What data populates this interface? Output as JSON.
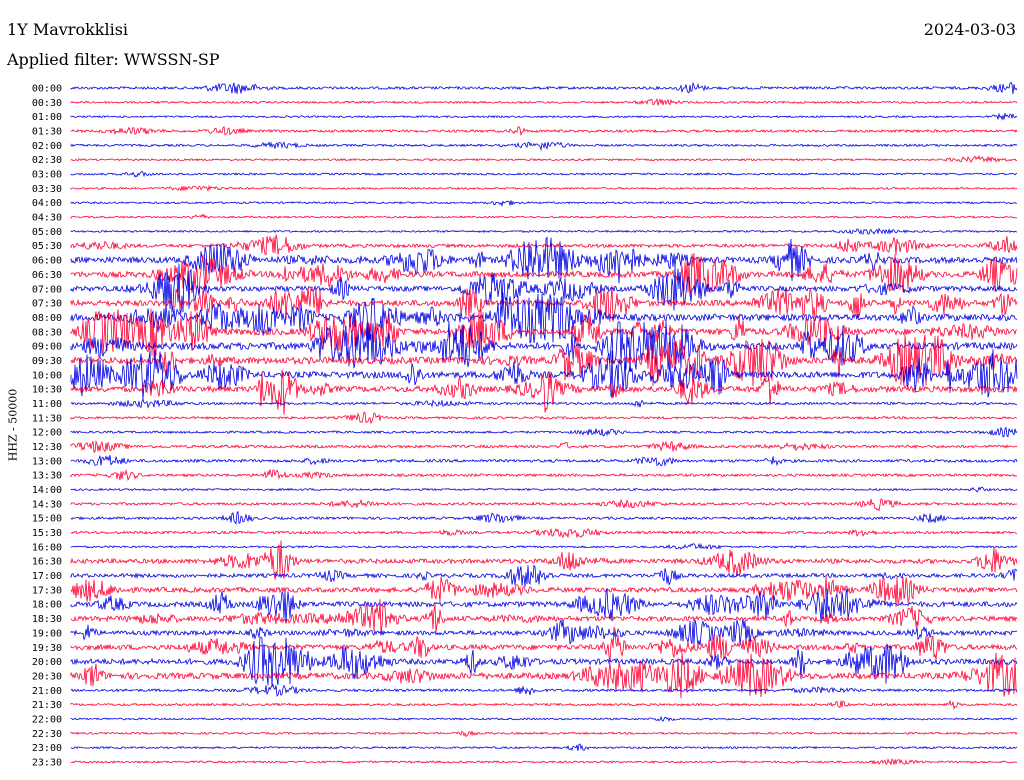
{
  "header": {
    "station": "1Y Mavrokklisi",
    "date": "2024-03-03",
    "filter": "Applied filter: WWSSN-SP"
  },
  "chart_data": {
    "type": "line",
    "title": "1Y Mavrokklisi",
    "ylabel": "HHZ - 50000",
    "colors": {
      "even": "#0000e6",
      "odd": "#ff0033"
    },
    "rows": [
      {
        "time": "00:00",
        "level": 0.32
      },
      {
        "time": "00:30",
        "level": 0.12
      },
      {
        "time": "01:00",
        "level": 0.05
      },
      {
        "time": "01:30",
        "level": 0.28
      },
      {
        "time": "02:00",
        "level": 0.18
      },
      {
        "time": "02:30",
        "level": 0.08
      },
      {
        "time": "03:00",
        "level": 0.08
      },
      {
        "time": "03:30",
        "level": 0.06
      },
      {
        "time": "04:00",
        "level": 0.06
      },
      {
        "time": "04:30",
        "level": 0.05
      },
      {
        "time": "05:00",
        "level": 0.08
      },
      {
        "time": "05:30",
        "level": 0.55
      },
      {
        "time": "06:00",
        "level": 1.4
      },
      {
        "time": "06:30",
        "level": 1.3
      },
      {
        "time": "07:00",
        "level": 1.1
      },
      {
        "time": "07:30",
        "level": 1.3
      },
      {
        "time": "08:00",
        "level": 1.6
      },
      {
        "time": "08:30",
        "level": 1.5
      },
      {
        "time": "09:00",
        "level": 1.7
      },
      {
        "time": "09:30",
        "level": 1.6
      },
      {
        "time": "10:00",
        "level": 1.5
      },
      {
        "time": "10:30",
        "level": 1.3
      },
      {
        "time": "11:00",
        "level": 0.25
      },
      {
        "time": "11:30",
        "level": 0.2
      },
      {
        "time": "12:00",
        "level": 0.18
      },
      {
        "time": "12:30",
        "level": 0.35
      },
      {
        "time": "13:00",
        "level": 0.38
      },
      {
        "time": "13:30",
        "level": 0.3
      },
      {
        "time": "14:00",
        "level": 0.12
      },
      {
        "time": "14:30",
        "level": 0.3
      },
      {
        "time": "15:00",
        "level": 0.28
      },
      {
        "time": "15:30",
        "level": 0.3
      },
      {
        "time": "16:00",
        "level": 0.1
      },
      {
        "time": "16:30",
        "level": 0.9
      },
      {
        "time": "17:00",
        "level": 0.7
      },
      {
        "time": "17:30",
        "level": 1.0
      },
      {
        "time": "18:00",
        "level": 1.1
      },
      {
        "time": "18:30",
        "level": 1.0
      },
      {
        "time": "19:00",
        "level": 0.9
      },
      {
        "time": "19:30",
        "level": 1.1
      },
      {
        "time": "20:00",
        "level": 1.2
      },
      {
        "time": "20:30",
        "level": 1.4
      },
      {
        "time": "21:00",
        "level": 0.3
      },
      {
        "time": "21:30",
        "level": 0.2
      },
      {
        "time": "22:00",
        "level": 0.05
      },
      {
        "time": "22:30",
        "level": 0.1
      },
      {
        "time": "23:00",
        "level": 0.08
      },
      {
        "time": "23:30",
        "level": 0.12
      }
    ]
  }
}
